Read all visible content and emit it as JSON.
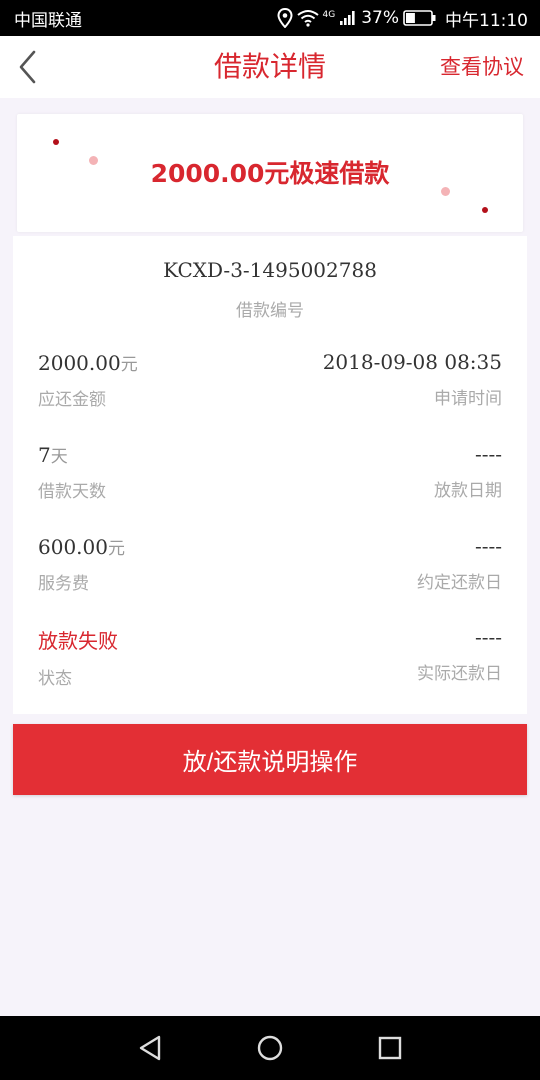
{
  "status_bar": {
    "carrier": "中国联通",
    "network": "4G",
    "battery": "37%",
    "battery_level": 0.37,
    "time": "中午11:10",
    "icons": [
      "location-icon",
      "wifi-icon",
      "signal-icon",
      "battery-icon"
    ]
  },
  "header": {
    "title": "借款详情",
    "agreement_link": "查看协议",
    "back_icon": "chevron-left-icon"
  },
  "banner": {
    "title": "2000.00元极速借款"
  },
  "details": {
    "loan_no": "KCXD-3-1495002788",
    "loan_no_label": "借款编号",
    "rows": [
      {
        "left": {
          "value": "2000.00",
          "unit": "元",
          "label": "应还金额"
        },
        "right": {
          "value": "2018-09-08 08:35",
          "label": "申请时间"
        }
      },
      {
        "left": {
          "value": "7",
          "unit": "天",
          "label": "借款天数"
        },
        "right": {
          "value": "----",
          "label": "放款日期"
        }
      },
      {
        "left": {
          "value": "600.00",
          "unit": "元",
          "label": "服务费"
        },
        "right": {
          "value": "----",
          "label": "约定还款日"
        }
      },
      {
        "left": {
          "value": "放款失败",
          "label": "状态"
        },
        "right": {
          "value": "----",
          "label": "实际还款日"
        }
      }
    ]
  },
  "action_button": {
    "label": "放/还款说明操作"
  },
  "system_nav": {
    "icons": [
      "back-triangle-icon",
      "home-circle-icon",
      "recents-square-icon"
    ]
  },
  "colors": {
    "accent": "#d8272f",
    "button": "#e32f35",
    "background": "#f6f3fa",
    "label_gray": "#aaaaaa"
  }
}
